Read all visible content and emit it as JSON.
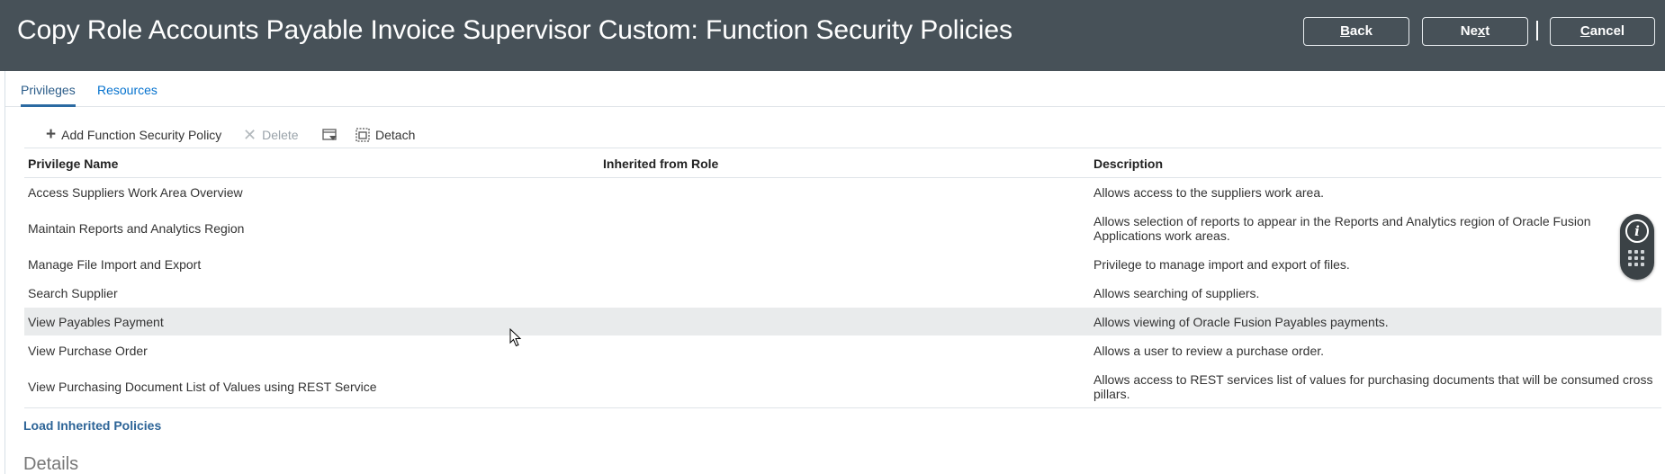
{
  "header": {
    "title": "Copy Role Accounts Payable Invoice Supervisor Custom: Function Security Policies",
    "back_prefix": "",
    "back_accel": "B",
    "back_rest": "ack",
    "next_prefix": "Ne",
    "next_accel": "x",
    "next_rest": "t",
    "cancel_prefix": "",
    "cancel_accel": "C",
    "cancel_rest": "ancel"
  },
  "tabs": [
    {
      "label": "Privileges",
      "active": true
    },
    {
      "label": "Resources",
      "active": false
    }
  ],
  "toolbar": {
    "add_label": "Add Function Security Policy",
    "delete_label": "Delete",
    "detach_label": "Detach"
  },
  "table": {
    "columns": [
      "Privilege Name",
      "Inherited from Role",
      "Description"
    ],
    "rows": [
      {
        "name": "Access Suppliers Work Area Overview",
        "inherited": "",
        "description": "Allows access to the suppliers work area."
      },
      {
        "name": "Maintain Reports and Analytics Region",
        "inherited": "",
        "description": "Allows selection of reports to appear in the Reports and Analytics region of Oracle Fusion Applications work areas."
      },
      {
        "name": "Manage File Import and Export",
        "inherited": "",
        "description": "Privilege to manage import and export of files."
      },
      {
        "name": "Search Supplier",
        "inherited": "",
        "description": "Allows searching of suppliers."
      },
      {
        "name": "View Payables Payment",
        "inherited": "",
        "description": "Allows viewing of Oracle Fusion Payables payments."
      },
      {
        "name": "View Purchase Order",
        "inherited": "",
        "description": "Allows a user to review a purchase order."
      },
      {
        "name": "View Purchasing Document List of Values using REST Service",
        "inherited": "",
        "description": "Allows access to REST services list of values for purchasing documents that will be consumed cross pillars."
      }
    ]
  },
  "links": {
    "load_inherited": "Load Inherited Policies"
  },
  "details": {
    "heading": "Details"
  },
  "colors": {
    "header_bg": "#475158",
    "link": "#2d6497",
    "hover_row": "#e9ebec"
  }
}
